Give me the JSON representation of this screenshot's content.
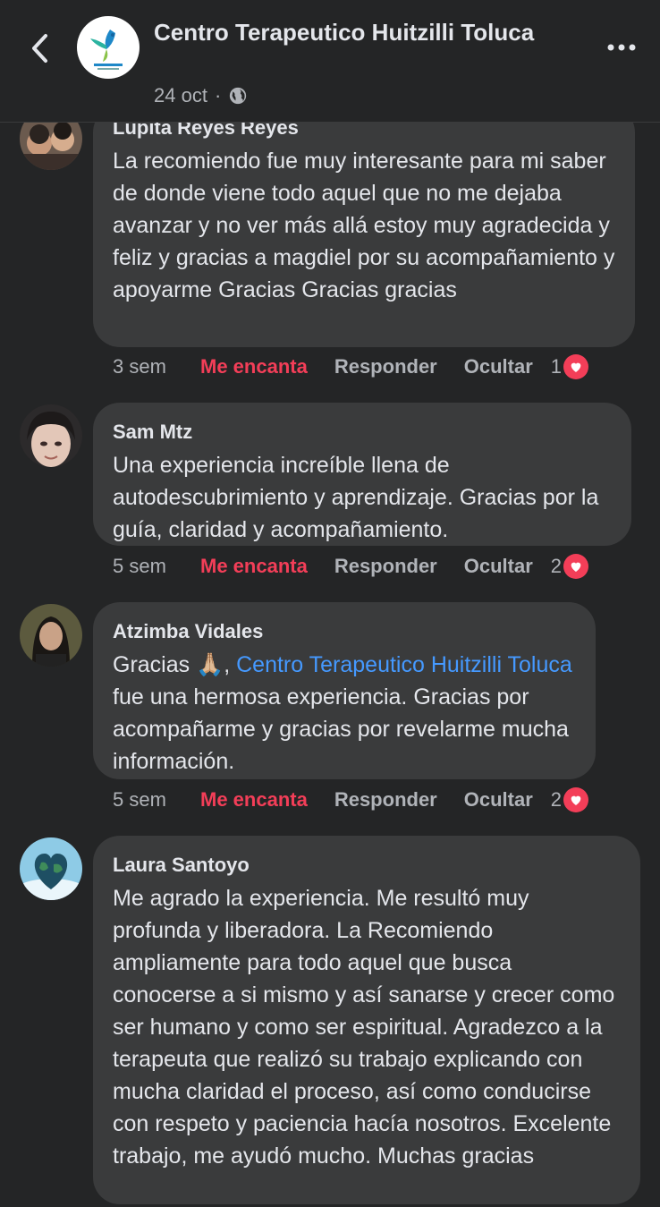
{
  "header": {
    "page_name": "Centro Terapeutico Huitzilli Toluca",
    "date": "24 oct",
    "separator": "·",
    "audience_icon": "globe-icon",
    "back_icon": "chevron-left-icon",
    "more_icon": "more-dots-icon"
  },
  "comments": [
    {
      "author": "Lupita Reyes Reyes",
      "text": "La recomiendo  fue  muy interesante para mi saber de donde viene todo aquel que  no me dejaba avanzar  y no ver  más allá estoy muy agradecida  y feliz y gracias  a magdiel por su acompañamiento  y apoyarme Gracias Gracias gracias",
      "time": "3 sem",
      "reaction_label": "Me encanta",
      "reply_label": "Responder",
      "hide_label": "Ocultar",
      "reaction_count": "1"
    },
    {
      "author": "Sam Mtz",
      "text": "Una experiencia increíble llena de autodescubrimiento y aprendizaje. Gracias por la guía, claridad y acompañamiento.",
      "time": "5 sem",
      "reaction_label": "Me encanta",
      "reply_label": "Responder",
      "hide_label": "Ocultar",
      "reaction_count": "2"
    },
    {
      "author": "Atzimba Vidales",
      "text_before": "Gracias 🙏🏼, ",
      "mention": "Centro Terapeutico Huitzilli Toluca",
      "text_after": " fue una hermosa experiencia. Gracias por acompañarme y gracias por revelarme mucha información.",
      "time": "5 sem",
      "reaction_label": "Me encanta",
      "reply_label": "Responder",
      "hide_label": "Ocultar",
      "reaction_count": "2"
    },
    {
      "author": "Laura Santoyo",
      "text": "Me agrado la experiencia. Me resultó muy profunda y liberadora. La Recomiendo ampliamente para todo aquel que busca conocerse a si mismo y así sanarse y crecer como ser humano y como ser espiritual. Agradezco a la terapeuta que realizó su trabajo explicando con mucha claridad el proceso, así como conducirse con respeto y paciencia hacía nosotros. Excelente trabajo, me ayudó mucho. Muchas gracias"
    }
  ],
  "colors": {
    "background": "#242526",
    "bubble": "#3a3b3c",
    "love_reaction": "#f33e58",
    "mention_link": "#4599ff"
  }
}
